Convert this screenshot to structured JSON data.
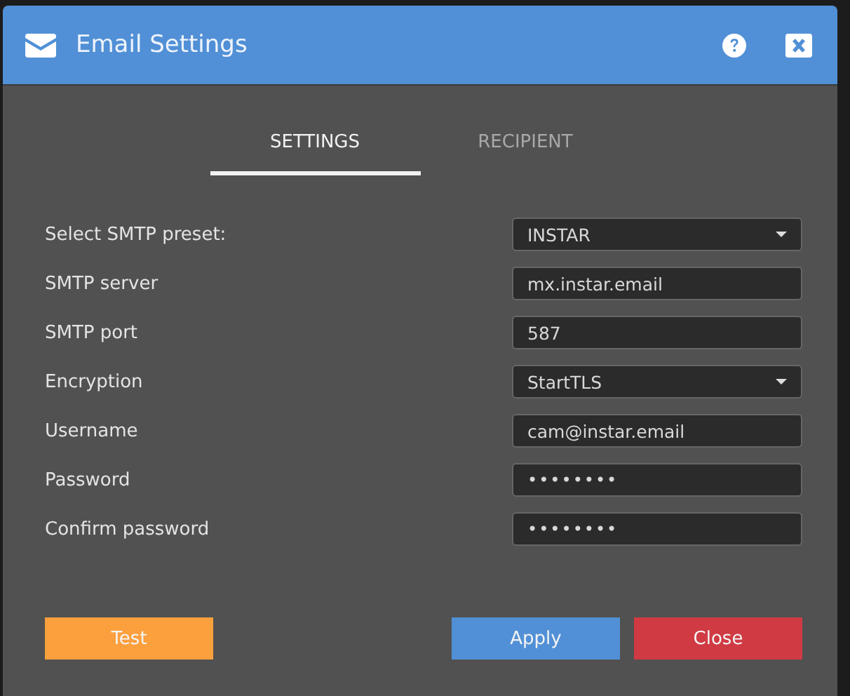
{
  "window": {
    "title": "Email Settings"
  },
  "tabs": [
    {
      "label": "SETTINGS",
      "selected": true
    },
    {
      "label": "RECIPIENT",
      "selected": false
    }
  ],
  "fields": [
    {
      "label": "Select SMTP preset:",
      "kind": "select",
      "value": "INSTAR"
    },
    {
      "label": "SMTP server",
      "kind": "text",
      "value": "mx.instar.email"
    },
    {
      "label": "SMTP port",
      "kind": "text",
      "value": "587"
    },
    {
      "label": "Encryption",
      "kind": "select",
      "value": "StartTLS"
    },
    {
      "label": "Username",
      "kind": "text",
      "value": "cam@instar.email"
    },
    {
      "label": "Password",
      "kind": "password",
      "value": "••••••••"
    },
    {
      "label": "Confirm password",
      "kind": "password",
      "value": "••••••••"
    }
  ],
  "buttons": [
    {
      "label": "Test",
      "color": "#fba03d"
    },
    {
      "label": "Apply",
      "color": "#5190d6"
    },
    {
      "label": "Close",
      "color": "#d03a43"
    }
  ]
}
